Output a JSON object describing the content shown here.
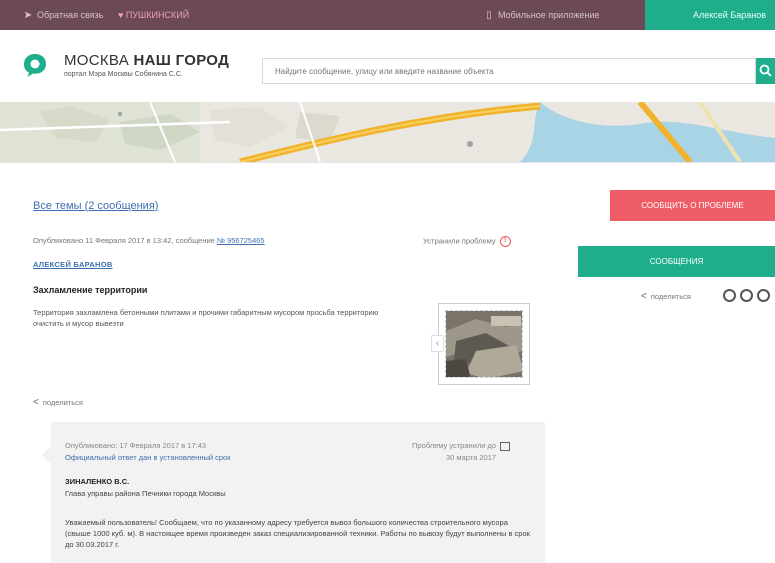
{
  "topbar": {
    "feedback_label": "Обратная связь",
    "heart_label": "♥ ПУШКИНСКИЙ",
    "mobile_label": "Мобильное приложение",
    "user_label": "Алексей Баранов"
  },
  "header": {
    "logo_title_light": "МОСКВА ",
    "logo_title_bold": "НАШ ГОРОД",
    "logo_subtitle": "портал Мэра Москвы Собянина С.С.",
    "search_placeholder": "Найдите сообщение, улицу или введите название объекта"
  },
  "topic": {
    "back_link": "Все темы (2 сообщения)",
    "pub_prefix": "Опубликовано 11 Февраля 2017 в 13:42, сообщение ",
    "pub_number": "№ 956725465",
    "resolved_label": "Устранили проблему",
    "author": "АЛЕКСЕЙ БАРАНОВ",
    "title": "Захламление территории",
    "text": "Территория захламлена бетонными плитами и прочими габаритным мусором просьба территорию очистить и мусор вывезти",
    "share_label": "поделиться"
  },
  "reply": {
    "published": "Опубликовано: 17 Февраля 2017 в 17:43",
    "official": "Официальный ответ дан в установленный срок",
    "resolved_by": "Проблему устранили до",
    "resolved_date": "30 марта 2017",
    "name": "ЗИНАЛЕНКО В.С.",
    "department": "Глава управы района Печники города Москвы",
    "text": "Уважаемый пользователь! Сообщаем, что по указанному адресу требуется вывоз большого количества строительного мусора (свыше 1000 куб. м). В настоящее время произведен заказ специализированной техники. Работы по вывозу будут выполнены в срок до 30.03.2017 г."
  },
  "sidebar": {
    "report_button": "СООБЩИТЬ О ПРОБЛЕМЕ",
    "messages_button": "СООБЩЕНИЯ",
    "share_label": "поделиться"
  },
  "colors": {
    "topbar": "#6b4a55",
    "accent_green": "#1fae8b",
    "report_red": "#ef5d66",
    "link_blue": "#3d6fae"
  },
  "icons": [
    "feedback-icon",
    "heart-icon",
    "mobile-icon",
    "search-icon",
    "share-icon",
    "alert-icon",
    "calendar-icon",
    "social-icon"
  ]
}
